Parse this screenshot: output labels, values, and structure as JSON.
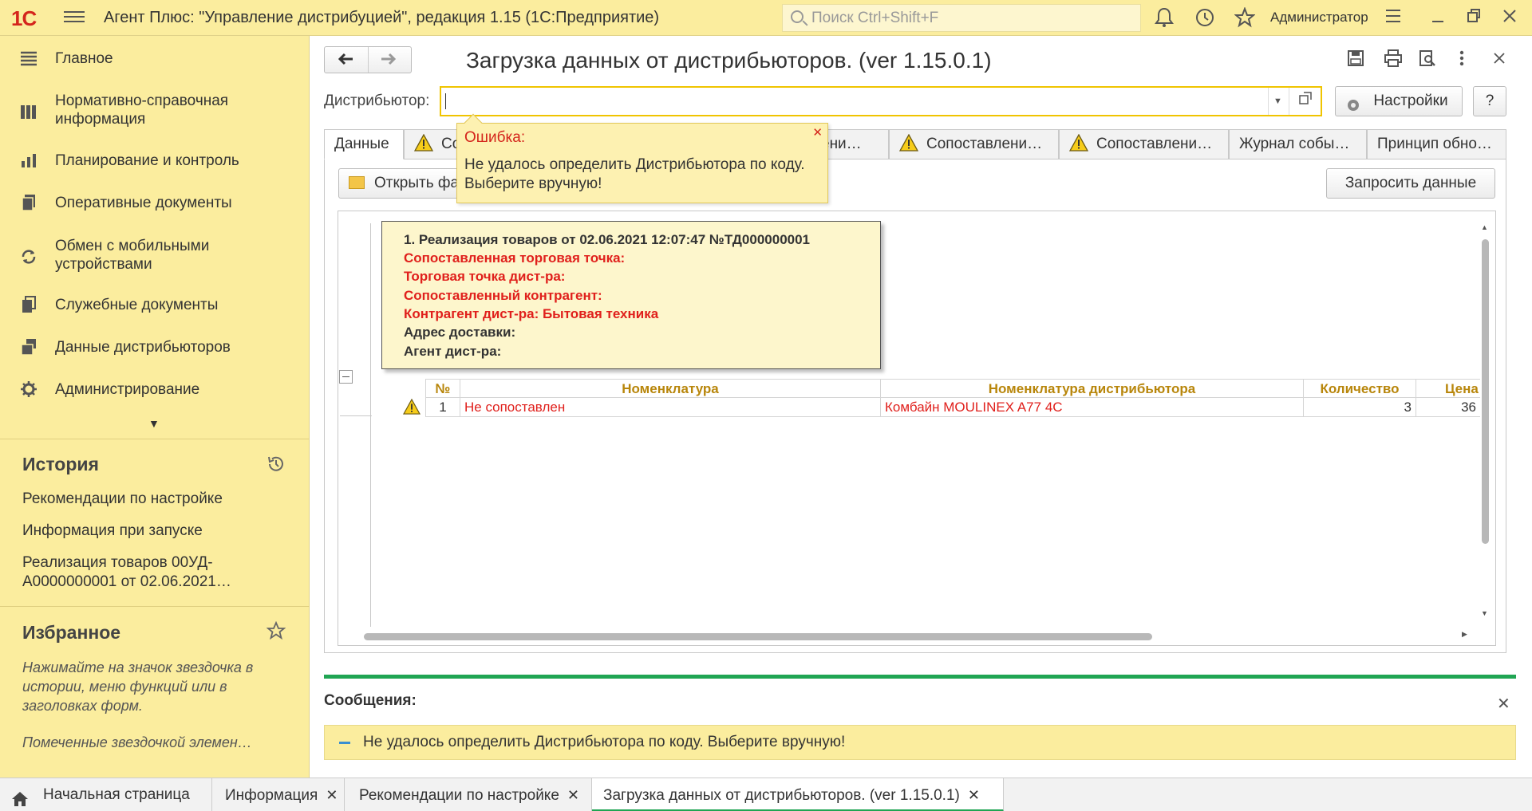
{
  "app": {
    "logo": "1С",
    "title": "Агент Плюс: \"Управление дистрибуцией\", редакция 1.15  (1С:Предприятие)",
    "search_placeholder": "Поиск Ctrl+Shift+F",
    "user": "Администратор"
  },
  "sidebar": {
    "items": [
      {
        "label": "Главное",
        "icon": "menu-icon"
      },
      {
        "label": "Нормативно-справочная информация",
        "icon": "books-icon"
      },
      {
        "label": "Планирование и контроль",
        "icon": "chart-icon"
      },
      {
        "label": "Оперативные документы",
        "icon": "documents-icon"
      },
      {
        "label": "Обмен с мобильными устройствами",
        "icon": "sync-icon"
      },
      {
        "label": "Служебные документы",
        "icon": "service-docs-icon"
      },
      {
        "label": "Данные дистрибьюторов",
        "icon": "distributor-data-icon"
      },
      {
        "label": "Администрирование",
        "icon": "gear-icon"
      }
    ],
    "history_title": "История",
    "history": [
      "Рекомендации по настройке",
      "Информация при запуске",
      "Реализация товаров 00УД-А0000000001 от 02.06.2021…"
    ],
    "favorites_title": "Избранное",
    "favorites_hint": "Нажимайте на значок звездочка в истории, меню функций или в заголовках форм.",
    "favorites_note": "Помеченные звездочкой элемен…"
  },
  "form": {
    "title": "Загрузка данных от дистрибьюторов. (ver 1.15.0.1)",
    "distributor_label": "Дистрибьютор:",
    "distributor_value": "",
    "settings_button": "Настройки",
    "help_button": "?",
    "tabs": [
      {
        "label": "Данные",
        "warn": false
      },
      {
        "label": "Со",
        "warn": true
      },
      {
        "label": "ени…",
        "warn": false
      },
      {
        "label": "Сопоставлени…",
        "warn": true
      },
      {
        "label": "Сопоставлени…",
        "warn": true
      },
      {
        "label": "Журнал собы…",
        "warn": false
      },
      {
        "label": "Принцип обно…",
        "warn": false
      }
    ],
    "open_file_button": "Открыть фа",
    "request_data_button": "Запросить данные"
  },
  "error_popup": {
    "title": "Ошибка:",
    "text": "Не удалось определить Дистрибьютора по коду. Выберите вручную!"
  },
  "tooltip": {
    "lines": [
      {
        "text": "1. Реализация товаров от 02.06.2021 12:07:47 №ТД000000001",
        "color": "#333333"
      },
      {
        "text": "Сопоставленная торговая точка:",
        "color": "#e0201c"
      },
      {
        "text": "Торговая точка дист-ра:",
        "color": "#e0201c"
      },
      {
        "text": "Сопоставленный контрагент:",
        "color": "#e0201c"
      },
      {
        "text": "Контрагент дист-ра: Бытовая техника",
        "color": "#e0201c"
      },
      {
        "text": "Адрес доставки:",
        "color": "#333333"
      },
      {
        "text": "Агент дист-ра:",
        "color": "#333333"
      }
    ]
  },
  "table": {
    "columns": [
      "№",
      "Номенклатура",
      "Номенклатура дистрибьютора",
      "Количество",
      "Цена"
    ],
    "rows": [
      {
        "num": "1",
        "nomenclature": "Не сопоставлен",
        "dist_nomenclature": "Комбайн MOULINEX  A77 4C",
        "qty": "3",
        "price": "36"
      }
    ]
  },
  "messages": {
    "title": "Сообщения:",
    "items": [
      "Не удалось определить Дистрибьютора по коду. Выберите вручную!"
    ]
  },
  "taskbar": {
    "items": [
      {
        "label": "Начальная страница",
        "closable": false
      },
      {
        "label": "Информация",
        "closable": true
      },
      {
        "label": "Рекомендации по настройке",
        "closable": true
      },
      {
        "label": "Загрузка данных от дистрибьюторов. (ver 1.15.0.1)",
        "closable": true
      }
    ]
  },
  "colors": {
    "accent_green": "#20a553",
    "error_red": "#e0201c",
    "header_gold": "#b8860b",
    "panel_yellow": "#fbed9e"
  }
}
